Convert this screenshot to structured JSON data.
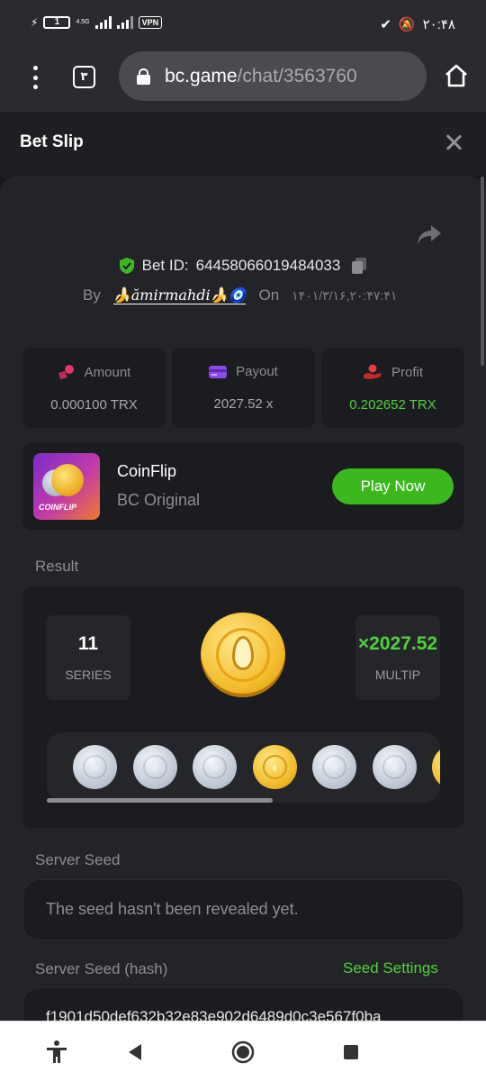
{
  "status_bar": {
    "battery": "1",
    "network": "4.5G",
    "vpn": "VPN",
    "time": "۲۰:۴۸"
  },
  "browser": {
    "tab_count": "۳",
    "url_host": "bc.game",
    "url_path": "/chat/3563760"
  },
  "modal": {
    "title": "Bet Slip"
  },
  "bet": {
    "bet_id_label": "Bet ID:",
    "bet_id": "64458066019484033",
    "by_label": "By",
    "username": "🍌ămirmahdi🍌🧿",
    "on_label": "On",
    "date": "۱۴۰۱/۳/۱۶,۲۰:۴۷:۴۱"
  },
  "stats": [
    {
      "label": "Amount",
      "value": "0.000100 TRX",
      "icon": "coins-icon",
      "color": "#e0386a"
    },
    {
      "label": "Payout",
      "value": "2027.52 x",
      "icon": "card-icon",
      "color": "#8b4be8"
    },
    {
      "label": "Profit",
      "value": "0.202652 TRX",
      "icon": "hand-coin-icon",
      "color": "#e83b3b"
    }
  ],
  "game": {
    "thumb_label": "COINFLIP",
    "name": "CoinFlip",
    "subtitle": "BC Original",
    "play_label": "Play Now"
  },
  "result": {
    "section_label": "Result",
    "series_value": "11",
    "series_label": "SERIES",
    "multiplier_value": "×2027.52",
    "multiplier_label": "MULTIP",
    "coins": [
      "silver",
      "silver",
      "silver",
      "gold",
      "silver",
      "silver",
      "gold"
    ]
  },
  "server_seed": {
    "label": "Server Seed",
    "value": "The seed hasn't been revealed yet."
  },
  "server_seed_hash": {
    "label": "Server Seed (hash)",
    "settings_link": "Seed Settings",
    "value": "f1901d50def632b32e83e902d6489d0c3e567f0ba"
  },
  "colors": {
    "accent_green": "#3cb81f",
    "profit_green": "#4fd23a",
    "background": "#17181b",
    "card": "#1b1c1f"
  }
}
